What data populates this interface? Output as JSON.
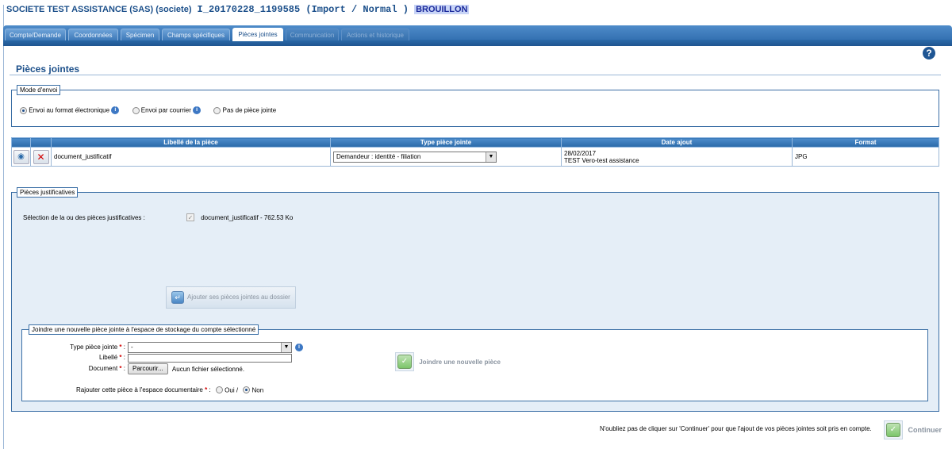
{
  "header": {
    "company": "SOCIETE TEST ASSISTANCE (SAS) (societe)",
    "reference": "I_20170228_1199585 (Import / Normal )",
    "status": "BROUILLON"
  },
  "tabs": [
    {
      "label": "Compte/Demande"
    },
    {
      "label": "Coordonnées"
    },
    {
      "label": "Spécimen"
    },
    {
      "label": "Champs spécifiques"
    },
    {
      "label": "Pièces jointes"
    },
    {
      "label": "Communication"
    },
    {
      "label": "Actions et historique"
    }
  ],
  "page": {
    "title": "Pièces jointes",
    "help_glyph": "?"
  },
  "mode_envoi": {
    "legend": "Mode d'envoi",
    "options": [
      {
        "label": "Envoi au format électronique",
        "selected": true
      },
      {
        "label": "Envoi par courrier",
        "selected": false
      },
      {
        "label": "Pas de pièce jointe",
        "selected": false
      }
    ]
  },
  "pieces_table": {
    "columns": [
      "Libellé de la pièce",
      "Type pièce jointe",
      "Date ajout",
      "Format"
    ],
    "rows": [
      {
        "label": "document_justificatif",
        "type": "Demandeur : identité - filiation",
        "date": "28/02/2017",
        "added_by": "TEST Vero-test assistance",
        "format": "JPG"
      }
    ]
  },
  "justificatives": {
    "legend": "Pièces justificatives",
    "selection_label": "Sélection de la ou des pièces justificatives :",
    "item_label": "document_justificatif - 762.53 Ko",
    "add_button": "Ajouter ses pièces jointes au dossier"
  },
  "nouvelle_piece": {
    "legend": "Joindre une nouvelle pièce jointe à l'espace de stockage du compte sélectionné",
    "type_label": "Type pièce jointe",
    "type_value": "-",
    "libelle_label": "Libellé",
    "document_label": "Document",
    "browse_button": "Parcourir...",
    "no_file": "Aucun fichier sélectionné.",
    "rajouter_label": "Rajouter cette pièce à l'espace documentaire",
    "oui": "Oui /",
    "non": "Non",
    "join_button": "Joindre une nouvelle pièce",
    "required_mark": "*",
    "colon": ":"
  },
  "footer": {
    "note": "N'oubliez pas de cliquer sur 'Continuer' pour que l'ajout de vos pièces jointes soit pris en compte.",
    "continue_button": "Continuer"
  },
  "colors": {
    "brand_blue": "#1b4f8a",
    "tab_bar": "#2966a8",
    "status_bg": "#c8d4f6",
    "required": "#d10000"
  },
  "icons": {
    "help": "help-icon",
    "delete": "delete-icon",
    "view": "view-icon",
    "info": "info-icon",
    "add": "add-attachments-icon",
    "join": "join-icon",
    "continue": "continue-icon"
  }
}
